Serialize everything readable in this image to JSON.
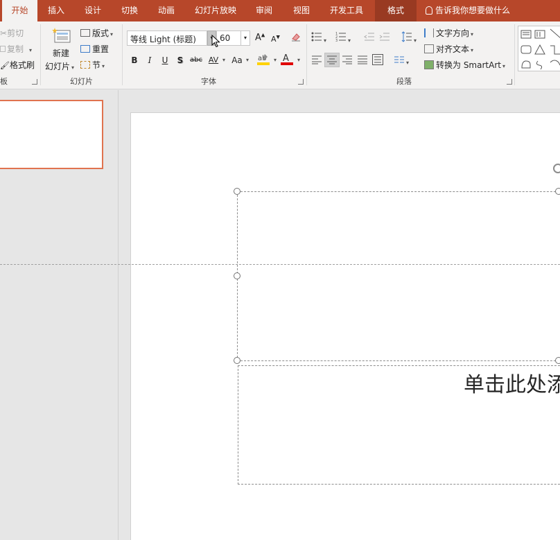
{
  "tabs": [
    {
      "label": "开始",
      "active": true
    },
    {
      "label": "插入"
    },
    {
      "label": "设计"
    },
    {
      "label": "切换"
    },
    {
      "label": "动画"
    },
    {
      "label": "幻灯片放映"
    },
    {
      "label": "审阅"
    },
    {
      "label": "视图"
    },
    {
      "label": "开发工具"
    },
    {
      "label": "格式",
      "context": true
    }
  ],
  "tell_me": "告诉我你想要做什么",
  "clipboard": {
    "cut": "剪切",
    "copy": "复制",
    "format_painter": "格式刷",
    "group_label": "板"
  },
  "slides_group": {
    "new_slide_line1": "新建",
    "new_slide_line2": "幻灯片",
    "layout": "版式",
    "reset": "重置",
    "section": "节",
    "group_label": "幻灯片"
  },
  "font_group": {
    "font_name": "等线 Light (标题)",
    "font_size": "60",
    "bold": "B",
    "italic": "I",
    "underline": "U",
    "shadow": "S",
    "strike": "abc",
    "spacing": "AV",
    "change_case": "Aa",
    "group_label": "字体"
  },
  "paragraph_group": {
    "text_direction": "文字方向",
    "align_text": "对齐文本",
    "convert_smartart": "转换为 SmartArt",
    "group_label": "段落"
  },
  "slide": {
    "subtitle_placeholder": "单击此处添"
  },
  "colors": {
    "brand": "#b7472a",
    "context_tab": "#993a22",
    "thumb_border": "#e0734f",
    "highlight": "#ffd200",
    "font_color": "#e00000"
  }
}
